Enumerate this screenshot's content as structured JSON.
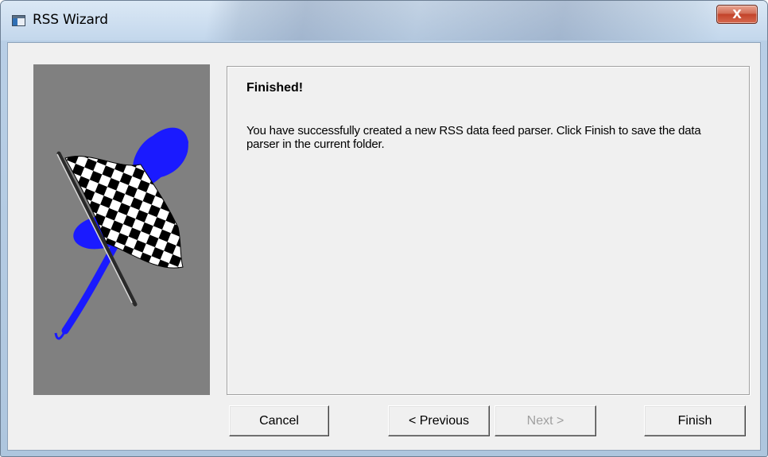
{
  "window": {
    "title": "RSS Wizard",
    "close_glyph": "X"
  },
  "panel": {
    "heading": "Finished!",
    "message": "You have successfully created a new RSS data feed parser. Click Finish to save the data parser in the current folder."
  },
  "buttons": {
    "cancel": "Cancel",
    "previous": "< Previous",
    "next": "Next >",
    "finish": "Finish"
  },
  "states": {
    "next_enabled": false
  },
  "colors": {
    "image_background": "#808080",
    "flag_blue": "#1a1aff"
  },
  "icons": {
    "app": "window-icon",
    "close": "close-icon",
    "side_image": "checkered-flag-icon"
  }
}
